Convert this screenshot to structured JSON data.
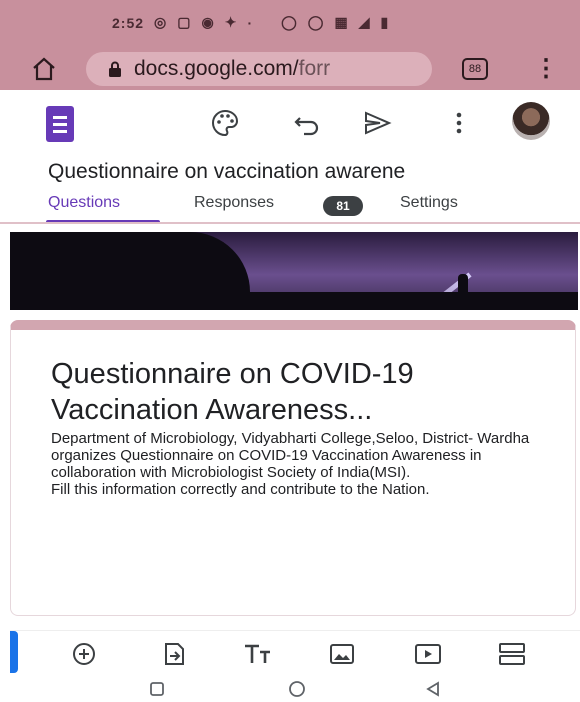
{
  "status_bar": {
    "time": "2:52",
    "battery_label": "Battery"
  },
  "browser": {
    "url_main": "docs.google.com/",
    "url_dim": "forr",
    "tab_count": "88"
  },
  "forms_toolbar": {
    "icons": [
      "palette-icon",
      "undo-icon",
      "send-icon",
      "more-vert-icon"
    ]
  },
  "document": {
    "title": "Questionnaire on vaccination awarene"
  },
  "tabs": [
    {
      "label": "Questions",
      "active": true
    },
    {
      "label": "Responses",
      "active": false
    },
    {
      "label": "Settings",
      "active": false
    }
  ],
  "responses_count": "81",
  "form": {
    "title": "Questionnaire on COVID-19 Vaccination Awareness...",
    "description": "Department of Microbiology, Vidyabharti College,Seloo, District- Wardha organizes Questionnaire on COVID-19 Vaccination Awareness  in collaboration with Microbiologist Society of India(MSI).\nFill this information correctly and contribute to the Nation."
  },
  "bottom_toolbar": {
    "icons": [
      "add-question-icon",
      "import-question-icon",
      "add-title-icon",
      "add-image-icon",
      "add-video-icon",
      "add-section-icon"
    ]
  },
  "colors": {
    "status_bar": "#c8909d",
    "forms_accent": "#673ab7",
    "card_top": "#d2a6b0"
  }
}
